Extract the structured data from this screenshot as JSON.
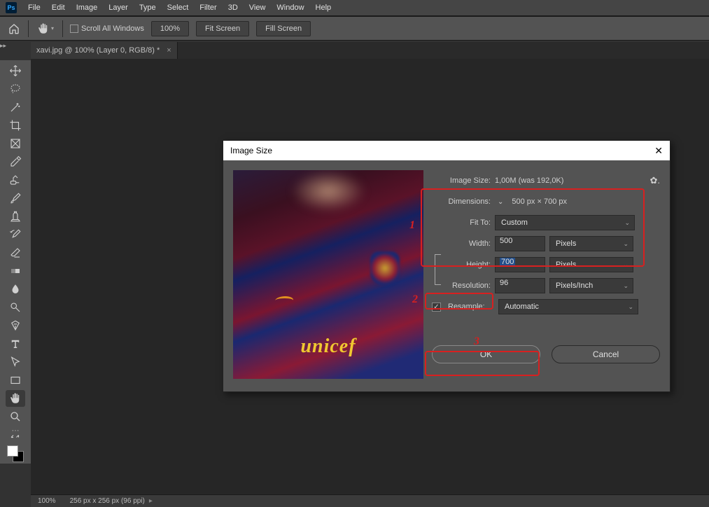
{
  "menu": {
    "items": [
      "File",
      "Edit",
      "Image",
      "Layer",
      "Type",
      "Select",
      "Filter",
      "3D",
      "View",
      "Window",
      "Help"
    ]
  },
  "options": {
    "scroll_all": "Scroll All Windows",
    "zoom": "100%",
    "fit": "Fit Screen",
    "fill": "Fill Screen"
  },
  "tab": {
    "title": "xavi.jpg @ 100% (Layer 0, RGB/8) *"
  },
  "status": {
    "zoom": "100%",
    "docinfo": "256 px x 256 px (96 ppi)"
  },
  "dialog": {
    "title": "Image Size",
    "image_size_lbl": "Image Size:",
    "image_size_val": "1,00M (was 192,0K)",
    "dimensions_lbl": "Dimensions:",
    "dimensions_val": "500 px  ×  700 px",
    "fitto_lbl": "Fit To:",
    "fitto_val": "Custom",
    "width_lbl": "Width:",
    "width_val": "500",
    "width_unit": "Pixels",
    "height_lbl": "Height:",
    "height_val": "700",
    "height_unit": "Pixels",
    "resolution_lbl": "Resolution:",
    "resolution_val": "96",
    "resolution_unit": "Pixels/Inch",
    "resample_lbl": "Resample:",
    "resample_val": "Automatic",
    "ok": "OK",
    "cancel": "Cancel",
    "preview_text": "unicef"
  },
  "annot": {
    "n1": "1",
    "n2": "2",
    "n3": "3"
  }
}
